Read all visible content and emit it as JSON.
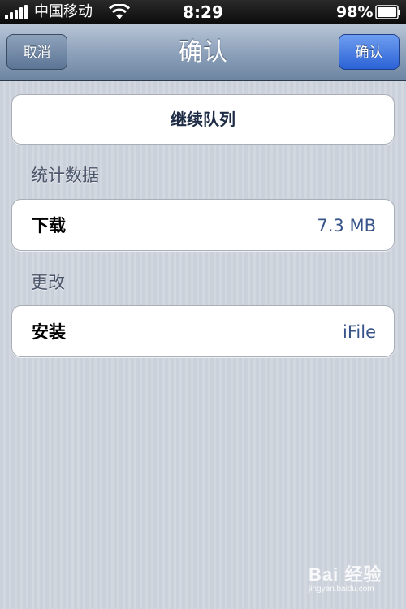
{
  "status_bar": {
    "carrier": "中国移动",
    "time": "8:29",
    "battery": "98%"
  },
  "nav": {
    "cancel_label": "取消",
    "title": "确认",
    "confirm_label": "确认"
  },
  "queue_button": {
    "label": "继续队列"
  },
  "stats": {
    "header": "统计数据",
    "rows": [
      {
        "label": "下载",
        "value": "7.3 MB"
      }
    ]
  },
  "changes": {
    "header": "更改",
    "rows": [
      {
        "label": "安装",
        "value": "iFile"
      }
    ]
  },
  "watermark": {
    "logo": "Bai 经验",
    "url": "jingyan.baidu.com"
  }
}
